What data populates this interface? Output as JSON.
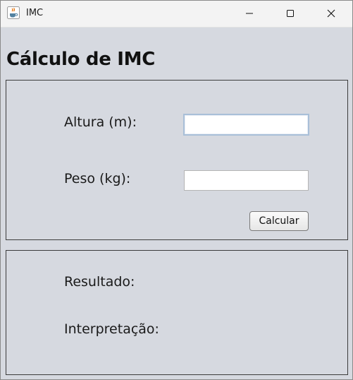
{
  "window": {
    "title": "IMC",
    "icon": "java-icon",
    "controls": [
      "minimize-icon",
      "maximize-icon",
      "close-icon"
    ]
  },
  "heading": "Cálculo de IMC",
  "form": {
    "height_label": "Altura (m):",
    "height_value": "",
    "weight_label": "Peso (kg):",
    "weight_value": "",
    "calculate_label": "Calcular"
  },
  "results": {
    "result_label": "Resultado:",
    "interpretation_label": "Interpretação:"
  }
}
